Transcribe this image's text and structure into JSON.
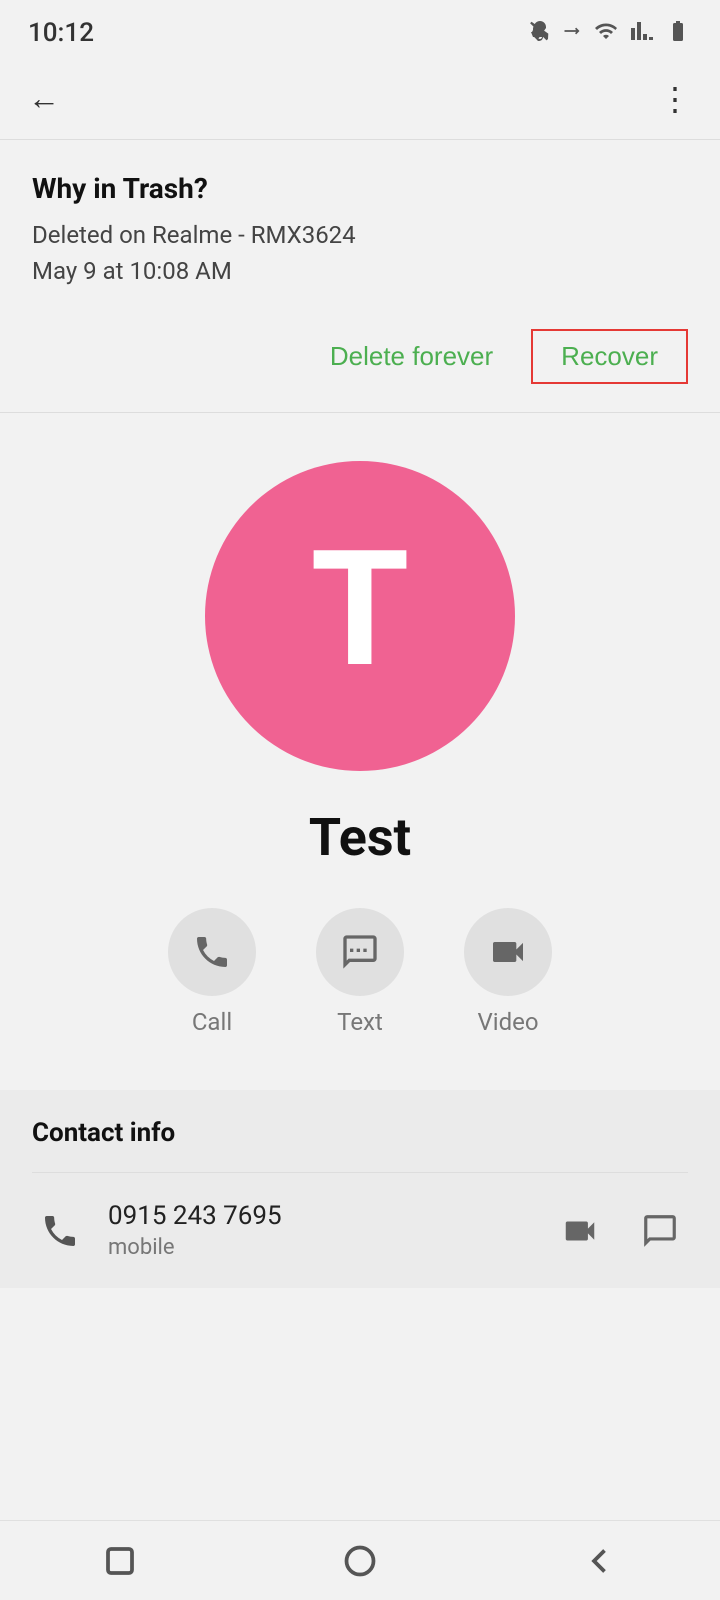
{
  "statusBar": {
    "time": "10:12",
    "icons": [
      "mute-icon",
      "bluetooth-icon",
      "wifi-icon",
      "signal-icon",
      "battery-icon"
    ]
  },
  "topBar": {
    "backLabel": "←",
    "moreLabel": "⋮"
  },
  "trashInfo": {
    "title": "Why in Trash?",
    "deletedOn": "Deleted on Realme - RMX3624",
    "deletedAt": "May 9 at 10:08 AM"
  },
  "actions": {
    "deleteForeverLabel": "Delete forever",
    "recoverLabel": "Recover"
  },
  "contact": {
    "avatarLetter": "T",
    "avatarColor": "#f06292",
    "name": "Test",
    "actions": [
      {
        "id": "call",
        "label": "Call"
      },
      {
        "id": "text",
        "label": "Text"
      },
      {
        "id": "video",
        "label": "Video"
      }
    ]
  },
  "contactInfo": {
    "sectionTitle": "Contact info",
    "phone": {
      "number": "0915 243 7695",
      "type": "mobile"
    }
  },
  "bottomNav": {
    "buttons": [
      "square-icon",
      "circle-icon",
      "triangle-icon"
    ]
  }
}
